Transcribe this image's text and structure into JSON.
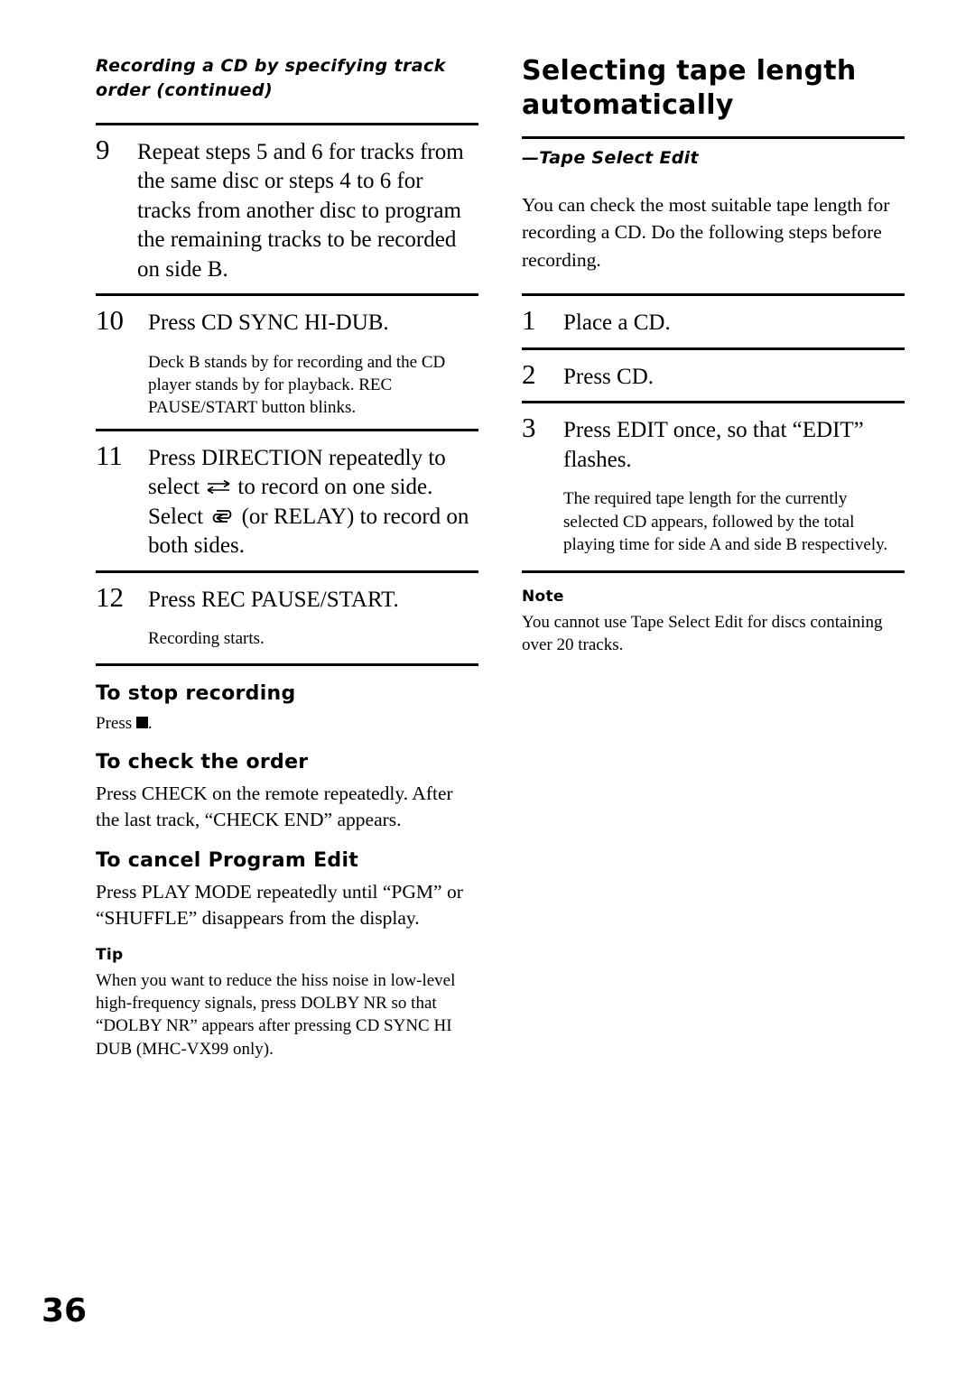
{
  "page": {
    "number": "36"
  },
  "left_column": {
    "running_head": "Recording a CD by specifying track order (continued)",
    "steps": [
      {
        "num": "9",
        "text": "Repeat steps 5 and 6 for tracks from the same disc or steps 4 to 6 for tracks from another disc to program the remaining tracks to be recorded on side B.",
        "note": ""
      },
      {
        "num": "10",
        "text": "Press CD SYNC HI-DUB.",
        "note": "Deck B stands by for recording and the CD player stands by for playback. REC PAUSE/START button blinks."
      },
      {
        "num": "11",
        "text_part1": "Press DIRECTION repeatedly to select",
        "text_part2": "to record on one side. Select",
        "text_part3": "(or RELAY) to record on both sides.",
        "icon1": "two-way-arrows-icon",
        "icon2": "loop-arrows-icon",
        "note": ""
      },
      {
        "num": "12",
        "text": "Press REC PAUSE/START.",
        "note": "Recording starts."
      }
    ],
    "sections": [
      {
        "heading": "To stop recording",
        "text_prefix": "Press ",
        "text_suffix": ".",
        "icon": "stop-square-icon"
      },
      {
        "heading": "To check the order",
        "text": "Press CHECK on the remote repeatedly. After the last track, “CHECK END” appears."
      },
      {
        "heading": "To cancel Program Edit",
        "text": "Press PLAY MODE repeatedly until “PGM” or “SHUFFLE” disappears from the display."
      }
    ],
    "tip": {
      "heading": "Tip",
      "text": "When you want to reduce the hiss noise in low-level high-frequency signals, press DOLBY NR so that “DOLBY NR” appears after pressing CD SYNC HI DUB (MHC-VX99 only)."
    }
  },
  "right_column": {
    "title": "Selecting tape length automatically",
    "subtitle": "—Tape Select Edit",
    "intro": "You can check the most suitable tape length for recording a CD. Do the following steps before recording.",
    "steps": [
      {
        "num": "1",
        "text": "Place a CD.",
        "note": ""
      },
      {
        "num": "2",
        "text": "Press CD.",
        "note": ""
      },
      {
        "num": "3",
        "text": "Press EDIT once, so that “EDIT” flashes.",
        "note": "The required tape length for the currently selected CD appears, followed by the total playing time for side A and side B respectively."
      }
    ],
    "note": {
      "heading": "Note",
      "text": "You cannot use Tape Select Edit for discs containing over 20 tracks."
    }
  }
}
